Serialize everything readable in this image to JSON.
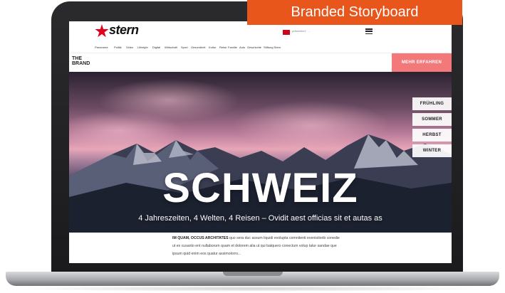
{
  "banner": {
    "label": "Branded Storyboard"
  },
  "header": {
    "logo_text": "stern",
    "sponsor_text": "präsentiert · ..."
  },
  "nav": {
    "items": [
      "Panorama",
      "Politik",
      "Video",
      "Lifestyle",
      "Digital",
      "Wirtschaft",
      "Sport",
      "Gesundheit",
      "Kultur",
      "Reise",
      "Familie",
      "Auto",
      "Geschichte",
      "Stiftung Stern"
    ]
  },
  "brand_bar": {
    "label": "THE\nBRAND",
    "cta_label": "MEHR ERFAHREN"
  },
  "hero": {
    "title": "SCHWEIZ",
    "subtitle": "4 Jahreszeiten, 4 Welten, 4 Reisen – Ovidit aest officias sit et autas as"
  },
  "seasons": [
    "FRÜHLING",
    "SOMMER",
    "HERBST",
    "WINTER"
  ],
  "article": {
    "lead": "IM QUAM, OCCUS ARCHITATES",
    "body": "quo sera duc assum liquidi evolupta comnitenti evenistiorib conedie ut ex cusanto ent nullaborum quam et dolorem alia ut qui batquero conectum volup tatur sandae que ipsum quid enim eos quatur assimolorro..."
  },
  "colors": {
    "banner": "#e8561c",
    "brand_red": "#e2001a",
    "cta": "#f2787a"
  }
}
